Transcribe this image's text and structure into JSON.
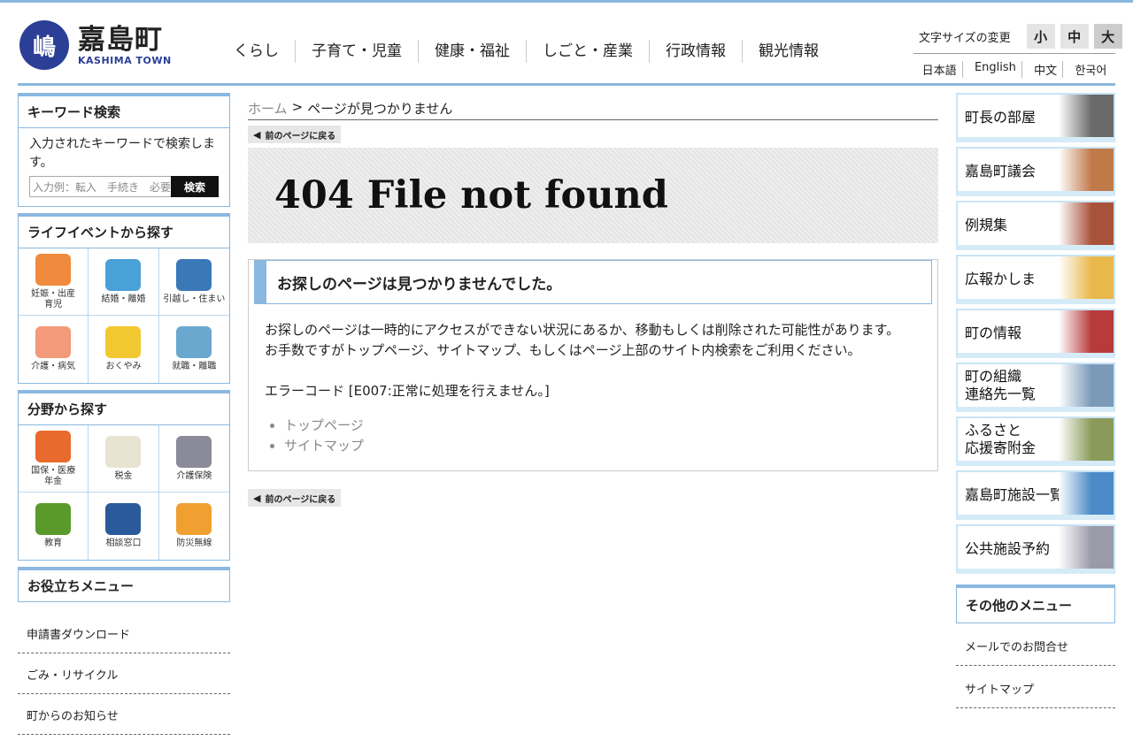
{
  "header": {
    "logo_mark": "嶋",
    "logo_ja": "嘉島町",
    "logo_en": "KASHIMA TOWN",
    "nav": [
      "くらし",
      "子育て・児童",
      "健康・福祉",
      "しごと・産業",
      "行政情報",
      "観光情報"
    ],
    "font_size_label": "文字サイズの変更",
    "font_sizes": [
      "小",
      "中",
      "大"
    ],
    "languages": [
      "日本語",
      "English",
      "中文",
      "한국어"
    ]
  },
  "left": {
    "keyword": {
      "title": "キーワード検索",
      "desc": "入力されたキーワードで検索します。",
      "placeholder": "入力例：転入　手続き　必要",
      "button": "検索"
    },
    "life": {
      "title": "ライフイベントから探す",
      "items": [
        {
          "label": "妊娠・出産\n育児",
          "color": "#f08a3c"
        },
        {
          "label": "結婚・離婚",
          "color": "#4aa0d8"
        },
        {
          "label": "引越し・住まい",
          "color": "#3a78b8"
        },
        {
          "label": "介護・病気",
          "color": "#f39a7a"
        },
        {
          "label": "おくやみ",
          "color": "#f2c830"
        },
        {
          "label": "就職・離職",
          "color": "#6aa8d0"
        }
      ]
    },
    "field": {
      "title": "分野から探す",
      "items": [
        {
          "label": "国保・医療\n年金",
          "color": "#e86a2c"
        },
        {
          "label": "税金",
          "color": "#e8e4d2"
        },
        {
          "label": "介護保険",
          "color": "#8a8a9a"
        },
        {
          "label": "教育",
          "color": "#5a9a2a"
        },
        {
          "label": "相談窓口",
          "color": "#2a5a9a"
        },
        {
          "label": "防災無線",
          "color": "#f0a030"
        }
      ]
    },
    "useful": {
      "title": "お役立ちメニュー",
      "items": [
        "申請書ダウンロード",
        "ごみ・リサイクル",
        "町からのお知らせ"
      ]
    }
  },
  "main": {
    "breadcrumb_home": "ホーム",
    "breadcrumb_sep": ">",
    "breadcrumb_current": "ページが見つかりません",
    "back_label": "前のページに戻る",
    "title": "404 File not found",
    "error_heading": "お探しのページは見つかりませんでした。",
    "error_text1": "お探しのページは一時的にアクセスができない状況にあるか、移動もしくは削除された可能性があります。",
    "error_text2": "お手数ですがトップページ、サイトマップ、もしくはページ上部のサイト内検索をご利用ください。",
    "error_code": "エラーコード [E007:正常に処理を行えません。]",
    "links": [
      "トップページ",
      "サイトマップ"
    ]
  },
  "right": {
    "banners": [
      {
        "label": "町長の部屋",
        "color": "#6a6a6a"
      },
      {
        "label": "嘉島町議会",
        "color": "#c07a4a"
      },
      {
        "label": "例規集",
        "color": "#a8523a"
      },
      {
        "label": "広報かしま",
        "color": "#e8b84a"
      },
      {
        "label": "町の情報",
        "color": "#b83a3a"
      },
      {
        "label": "町の組織\n連絡先一覧",
        "color": "#7a9ab8"
      },
      {
        "label": "ふるさと\n応援寄附金",
        "color": "#8a9a5a"
      },
      {
        "label": "嘉島町施設一覧",
        "color": "#4a8ac8"
      },
      {
        "label": "公共施設予約",
        "color": "#9a9aa8"
      }
    ],
    "other": {
      "title": "その他のメニュー",
      "items": [
        "メールでのお問合せ",
        "サイトマップ"
      ]
    }
  }
}
